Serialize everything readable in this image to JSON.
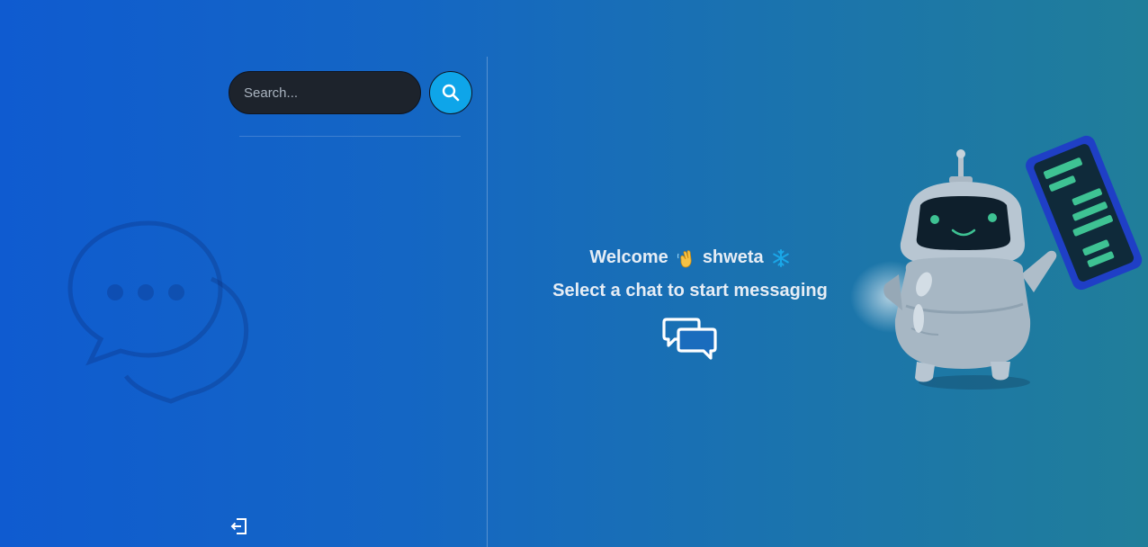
{
  "search": {
    "placeholder": "Search..."
  },
  "welcome": {
    "greeting": "Welcome",
    "username": "shweta",
    "subtitle": "Select a chat to start messaging"
  },
  "icons": {
    "search": "search-icon",
    "logout": "logout-icon",
    "chat": "chat-bubbles-icon",
    "wave": "waving-hand-icon",
    "snowflake": "snowflake-icon"
  },
  "colors": {
    "search_button": "#0ea5e9",
    "search_input_bg": "#1d232c"
  }
}
